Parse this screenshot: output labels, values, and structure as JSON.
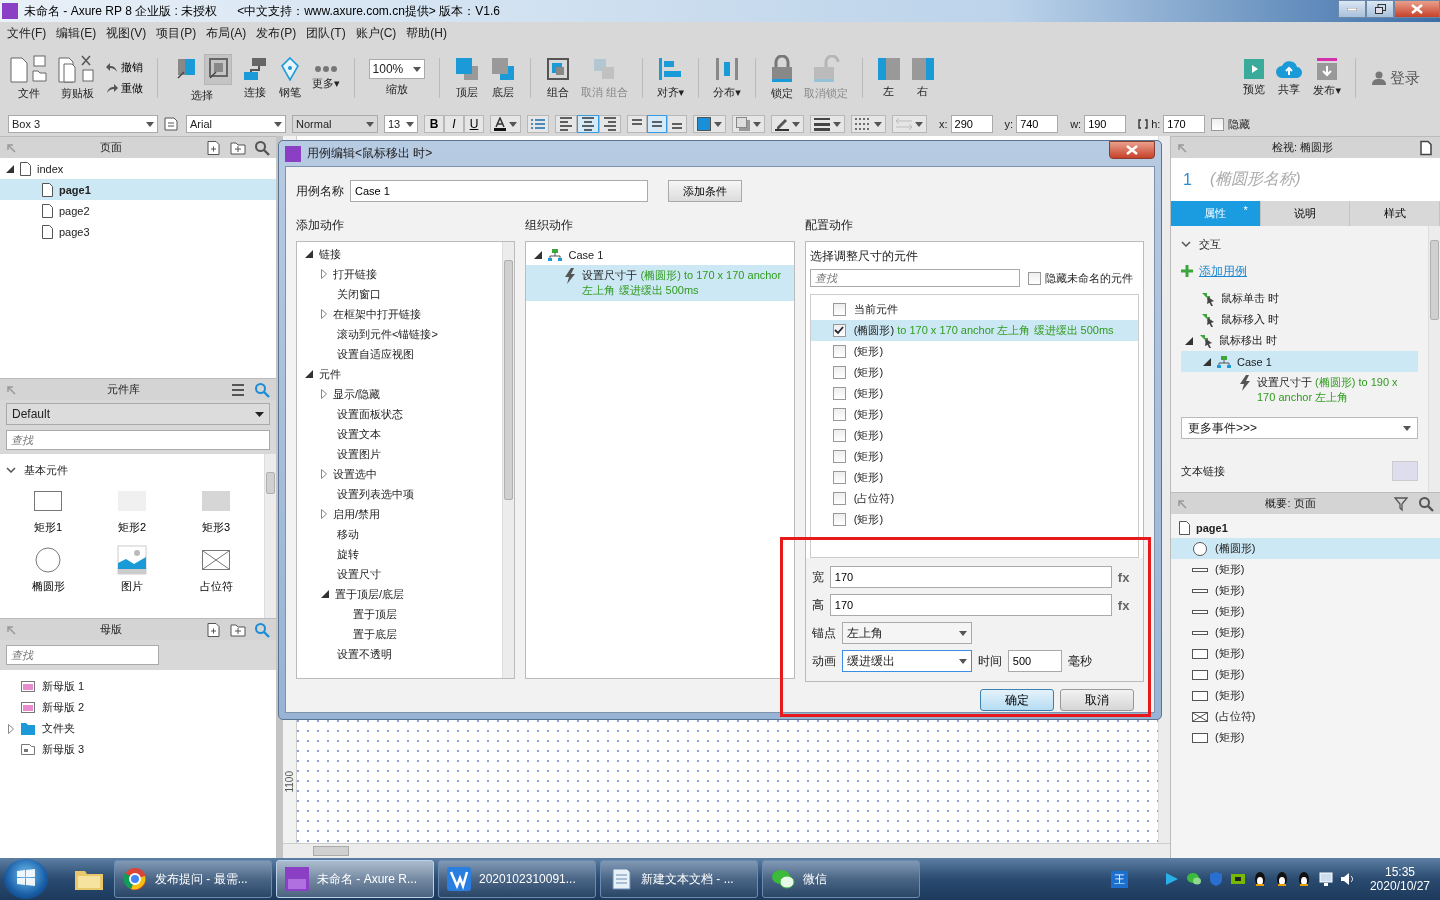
{
  "window": {
    "title": "未命名 - Axure RP 8 企业版 : 未授权",
    "subtitle": "<中文支持：www.axure.com.cn提供> 版本：V1.6"
  },
  "menu": [
    "文件(F)",
    "编辑(E)",
    "视图(V)",
    "项目(P)",
    "布局(A)",
    "发布(P)",
    "团队(T)",
    "账户(C)",
    "帮助(H)"
  ],
  "toolbar": [
    {
      "kind": "file",
      "label": "文件",
      "disabled": false
    },
    {
      "kind": "clipboard",
      "label": "剪贴板",
      "disabled": false
    },
    {
      "kind": "undo",
      "label": "撤销",
      "disabled": false
    },
    {
      "kind": "redo",
      "label": "重做",
      "disabled": false
    },
    {
      "kind": "separator"
    },
    {
      "kind": "select",
      "label": "选择",
      "disabled": false,
      "options": [
        {
          "selected": false
        },
        {
          "selected": true
        }
      ]
    },
    {
      "kind": "connect",
      "label": "连接",
      "disabled": false
    },
    {
      "kind": "pen",
      "label": "钢笔",
      "disabled": false
    },
    {
      "kind": "more",
      "label": "更多▾",
      "disabled": false
    },
    {
      "kind": "separator"
    },
    {
      "kind": "zoom",
      "value": "100%",
      "label": "缩放",
      "disabled": false
    },
    {
      "kind": "separator"
    },
    {
      "kind": "front",
      "label": "顶层",
      "disabled": false
    },
    {
      "kind": "back",
      "label": "底层",
      "disabled": false
    },
    {
      "kind": "separator"
    },
    {
      "kind": "group",
      "label": "组合",
      "disabled": false
    },
    {
      "kind": "ungroup",
      "label": "取消 组合",
      "disabled": true
    },
    {
      "kind": "separator"
    },
    {
      "kind": "align",
      "label": "对齐▾",
      "disabled": false
    },
    {
      "kind": "separator"
    },
    {
      "kind": "distribute",
      "label": "分布▾",
      "disabled": false
    },
    {
      "kind": "separator"
    },
    {
      "kind": "lock",
      "label": "锁定",
      "disabled": false
    },
    {
      "kind": "unlock",
      "label": "取消锁定",
      "disabled": true
    },
    {
      "kind": "separator"
    },
    {
      "kind": "left",
      "label": "左",
      "disabled": false
    },
    {
      "kind": "right",
      "label": "右",
      "disabled": false
    },
    {
      "kind": "spacer"
    },
    {
      "kind": "preview",
      "label": "预览",
      "disabled": false
    },
    {
      "kind": "share",
      "label": "共享",
      "disabled": false
    },
    {
      "kind": "publish",
      "label": "发布▾",
      "disabled": false
    },
    {
      "kind": "separator"
    },
    {
      "kind": "login",
      "label": "登录",
      "disabled": false
    }
  ],
  "format_bar": {
    "widget_name": "Box 3",
    "font": "Arial",
    "weight": "Normal",
    "size": "13",
    "styles": [
      {
        "kind": "bold",
        "label": "B",
        "on": false
      },
      {
        "kind": "italic",
        "label": "I",
        "on": false
      },
      {
        "kind": "underline",
        "label": "U",
        "on": false
      }
    ],
    "text_align": [
      {
        "kind": "left",
        "selected": false
      },
      {
        "kind": "center",
        "selected": true
      },
      {
        "kind": "right",
        "selected": false
      }
    ],
    "vertical_align": [
      {
        "kind": "top",
        "selected": false
      },
      {
        "kind": "middle",
        "selected": true
      },
      {
        "kind": "bottom",
        "selected": false
      }
    ],
    "geometry": [
      {
        "label": "x:",
        "value": "290"
      },
      {
        "label": "y:",
        "value": "740"
      },
      {
        "label": "w:",
        "value": "190"
      },
      {
        "label": "h:",
        "value": "170"
      }
    ],
    "hidden": {
      "label": "隐藏",
      "checked": false
    }
  },
  "pages": {
    "title": "页面",
    "tree": [
      {
        "label": "index",
        "expanded": true,
        "selected": false,
        "children": [
          {
            "label": "page1",
            "selected": true
          },
          {
            "label": "page2",
            "selected": false
          },
          {
            "label": "page3",
            "selected": false
          }
        ]
      }
    ]
  },
  "library": {
    "title": "元件库",
    "library": "Default",
    "search_placeholder": "查找",
    "section": "基本元件",
    "section_expanded": true,
    "widgets": [
      {
        "kind": "box-outline",
        "label": "矩形1"
      },
      {
        "kind": "box-light",
        "label": "矩形2"
      },
      {
        "kind": "box-grey",
        "label": "矩形3"
      },
      {
        "kind": "ellipse",
        "label": "椭圆形"
      },
      {
        "kind": "image",
        "label": "图片"
      },
      {
        "kind": "placeholder",
        "label": "占位符"
      }
    ]
  },
  "masters": {
    "title": "母版",
    "search_placeholder": "查找",
    "items": [
      {
        "kind": "master",
        "label": "新母版 1"
      },
      {
        "kind": "master",
        "label": "新母版 2"
      },
      {
        "kind": "folder",
        "label": "文件夹",
        "expanded": false
      },
      {
        "kind": "master-alt",
        "label": "新母版 3"
      }
    ]
  },
  "canvas": {
    "ruler_label": "1100"
  },
  "dialog": {
    "title": "用例编辑<鼠标移出 时>",
    "case_label": "用例名称",
    "case_name": "Case 1",
    "add_condition": "添加条件",
    "add_action": {
      "title": "添加动作",
      "tree": [
        {
          "label": "链接",
          "expanded": true,
          "children": [
            {
              "label": "打开链接",
              "expanded": false
            },
            {
              "label": "关闭窗口"
            },
            {
              "label": "在框架中打开链接",
              "expanded": false
            },
            {
              "label": "滚动到元件<锚链接>"
            },
            {
              "label": "设置自适应视图"
            }
          ]
        },
        {
          "label": "元件",
          "expanded": true,
          "children": [
            {
              "label": "显示/隐藏",
              "expanded": false
            },
            {
              "label": "设置面板状态"
            },
            {
              "label": "设置文本"
            },
            {
              "label": "设置图片"
            },
            {
              "label": "设置选中",
              "expanded": false
            },
            {
              "label": "设置列表选中项"
            },
            {
              "label": "启用/禁用",
              "expanded": false
            },
            {
              "label": "移动"
            },
            {
              "label": "旋转"
            },
            {
              "label": "设置尺寸"
            },
            {
              "label": "置于顶层/底层",
              "expanded": true,
              "children": [
                {
                  "label": "置于顶层"
                },
                {
                  "label": "置于底层"
                }
              ]
            },
            {
              "label": "设置不透明"
            }
          ]
        }
      ]
    },
    "organize": {
      "title": "组织动作",
      "case": {
        "label": "Case 1",
        "expanded": true,
        "actions": [
          {
            "verb": "设置尺寸于",
            "detail": "(椭圆形) to 170 x 170 anchor 左上角 缓进缓出 500ms",
            "selected": true
          }
        ]
      }
    },
    "configure": {
      "title": "配置动作",
      "subtitle": "选择调整尺寸的元件",
      "search_placeholder": "查找",
      "hide_unnamed": {
        "label": "隐藏未命名的元件",
        "checked": false
      },
      "widgets": [
        {
          "label": "当前元件",
          "checked": false,
          "selected": false
        },
        {
          "label": "(椭圆形)",
          "detail": "to 170 x 170 anchor 左上角 缓进缓出 500ms",
          "checked": true,
          "selected": true
        },
        {
          "label": "(矩形)",
          "checked": false,
          "selected": false
        },
        {
          "label": "(矩形)",
          "checked": false,
          "selected": false
        },
        {
          "label": "(矩形)",
          "checked": false,
          "selected": false
        },
        {
          "label": "(矩形)",
          "checked": false,
          "selected": false
        },
        {
          "label": "(矩形)",
          "checked": false,
          "selected": false
        },
        {
          "label": "(矩形)",
          "checked": false,
          "selected": false
        },
        {
          "label": "(矩形)",
          "checked": false,
          "selected": false
        },
        {
          "label": "(占位符)",
          "checked": false,
          "selected": false
        },
        {
          "label": "(矩形)",
          "checked": false,
          "selected": false
        }
      ],
      "width": {
        "label": "宽",
        "value": "170",
        "fx": "fx"
      },
      "height": {
        "label": "高",
        "value": "170",
        "fx": "fx"
      },
      "anchor": {
        "label": "锚点",
        "value": "左上角",
        "focused": false
      },
      "animation": {
        "label": "动画",
        "value": "缓进缓出",
        "focused": true
      },
      "time": {
        "label": "时间",
        "value": "500",
        "unit": "毫秒"
      }
    },
    "buttons": [
      {
        "label": "确定",
        "default": true
      },
      {
        "label": "取消",
        "default": false
      }
    ]
  },
  "inspector": {
    "title": "检视: 椭圆形",
    "number": "1",
    "name_placeholder": "(椭圆形名称)",
    "tabs": [
      {
        "label": "属性",
        "marker": "*",
        "selected": true
      },
      {
        "label": "说明",
        "selected": false
      },
      {
        "label": "样式",
        "selected": false
      }
    ],
    "section": "交互",
    "section_expanded": true,
    "add_case": "添加用例",
    "events": [
      {
        "label": "鼠标单击 时",
        "selected": false
      },
      {
        "label": "鼠标移入 时",
        "selected": false
      },
      {
        "label": "鼠标移出 时",
        "selected": false,
        "expanded": true,
        "cases": [
          {
            "label": "Case 1",
            "selected": true,
            "expanded": true,
            "actions": [
              {
                "verb": "设置尺寸于",
                "detail": "(椭圆形) to 190 x 170 anchor 左上角"
              }
            ]
          }
        ]
      }
    ],
    "more_events": "更多事件>>>",
    "text_link": "文本链接"
  },
  "outline": {
    "title": "概要: 页面",
    "page": "page1",
    "items": [
      {
        "kind": "ellipse",
        "label": "(椭圆形)",
        "selected": true
      },
      {
        "kind": "line",
        "label": "(矩形)",
        "selected": false
      },
      {
        "kind": "line",
        "label": "(矩形)",
        "selected": false
      },
      {
        "kind": "line",
        "label": "(矩形)",
        "selected": false
      },
      {
        "kind": "line",
        "label": "(矩形)",
        "selected": false
      },
      {
        "kind": "box",
        "label": "(矩形)",
        "selected": false
      },
      {
        "kind": "box",
        "label": "(矩形)",
        "selected": false
      },
      {
        "kind": "box",
        "label": "(矩形)",
        "selected": false
      },
      {
        "kind": "placeholder",
        "label": "(占位符)",
        "selected": false
      },
      {
        "kind": "box",
        "label": "(矩形)",
        "selected": false
      }
    ]
  },
  "taskbar": {
    "tasks": [
      {
        "kind": "browser",
        "label": "发布提问 - 最需...",
        "active": false
      },
      {
        "kind": "axure",
        "label": "未命名 - Axure R...",
        "active": true
      },
      {
        "kind": "editor",
        "label": "2020102310091...",
        "active": false
      },
      {
        "kind": "notepad",
        "label": "新建文本文档 - ...",
        "active": false
      },
      {
        "kind": "chat",
        "label": "微信",
        "active": false
      }
    ],
    "ime": "王",
    "tray": [
      {
        "kind": "player"
      },
      {
        "kind": "chat"
      },
      {
        "kind": "shield"
      },
      {
        "kind": "gpu"
      },
      {
        "kind": "penguin"
      },
      {
        "kind": "penguin"
      },
      {
        "kind": "penguin"
      },
      {
        "kind": "network"
      },
      {
        "kind": "volume"
      }
    ],
    "time": "15:35",
    "date": "2020/10/27"
  }
}
